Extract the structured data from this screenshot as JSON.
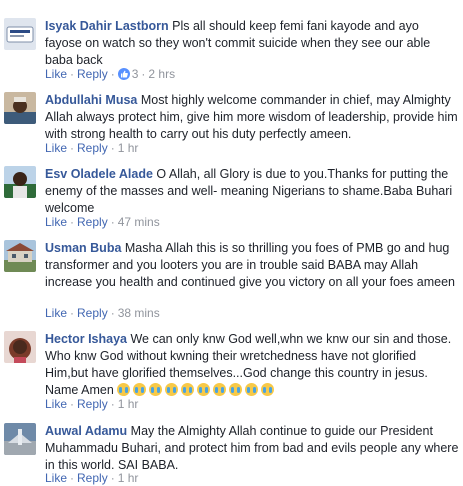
{
  "comments": [
    {
      "name": "Isyak Dahir Lastborn",
      "text": "Pls all should keep femi fani kayode and ayo fayose on watch so they won't commit suicide when they see our able baba back",
      "like": "Like",
      "reply": "Reply",
      "reactions": "3",
      "time": "2 hrs"
    },
    {
      "name": "Abdullahi Musa",
      "text": "Most highly welcome commander in chief, may Almighty Allah always protect him, give him more wisdom of leadership, provide him with strong health to carry out his duty perfectly ameen.",
      "like": "Like",
      "reply": "Reply",
      "time": "1 hr"
    },
    {
      "name": "Esv Oladele Alade",
      "text": "O Allah, all Glory is due to you.Thanks for putting the enemy of the masses and well- meaning Nigerians to shame.Baba Buhari welcome",
      "like": "Like",
      "reply": "Reply",
      "time": "47 mins"
    },
    {
      "name": "Usman Buba",
      "text": "Masha Allah this is so thrilling you foes of PMB go and hug transformer and you looters you are in trouble said BABA may Allah increase you health and continued give you victory on all your foes ameen",
      "like": "Like",
      "reply": "Reply",
      "time": "38 mins"
    },
    {
      "name": "Hector Ishaya",
      "text": "We can only knw God well,whn we knw our sin and those. Who knw God without kwning their wretchedness have not glorified Him,but have glorified themselves...God change this country in jesus. Name Amen",
      "emoji_count": 10,
      "like": "Like",
      "reply": "Reply",
      "time": "1 hr"
    },
    {
      "name": "Auwal Adamu",
      "text": "May the Almighty Allah continue to guide our President Muhammadu Buhari, and protect him from bad and evils people any where in this world. SAI BABA.",
      "like": "Like",
      "reply": "Reply",
      "time": "1 hr"
    }
  ],
  "colors": {
    "name": "#365899",
    "action": "#4267b2",
    "meta": "#90949c",
    "like_bubble": "#5890ff"
  }
}
